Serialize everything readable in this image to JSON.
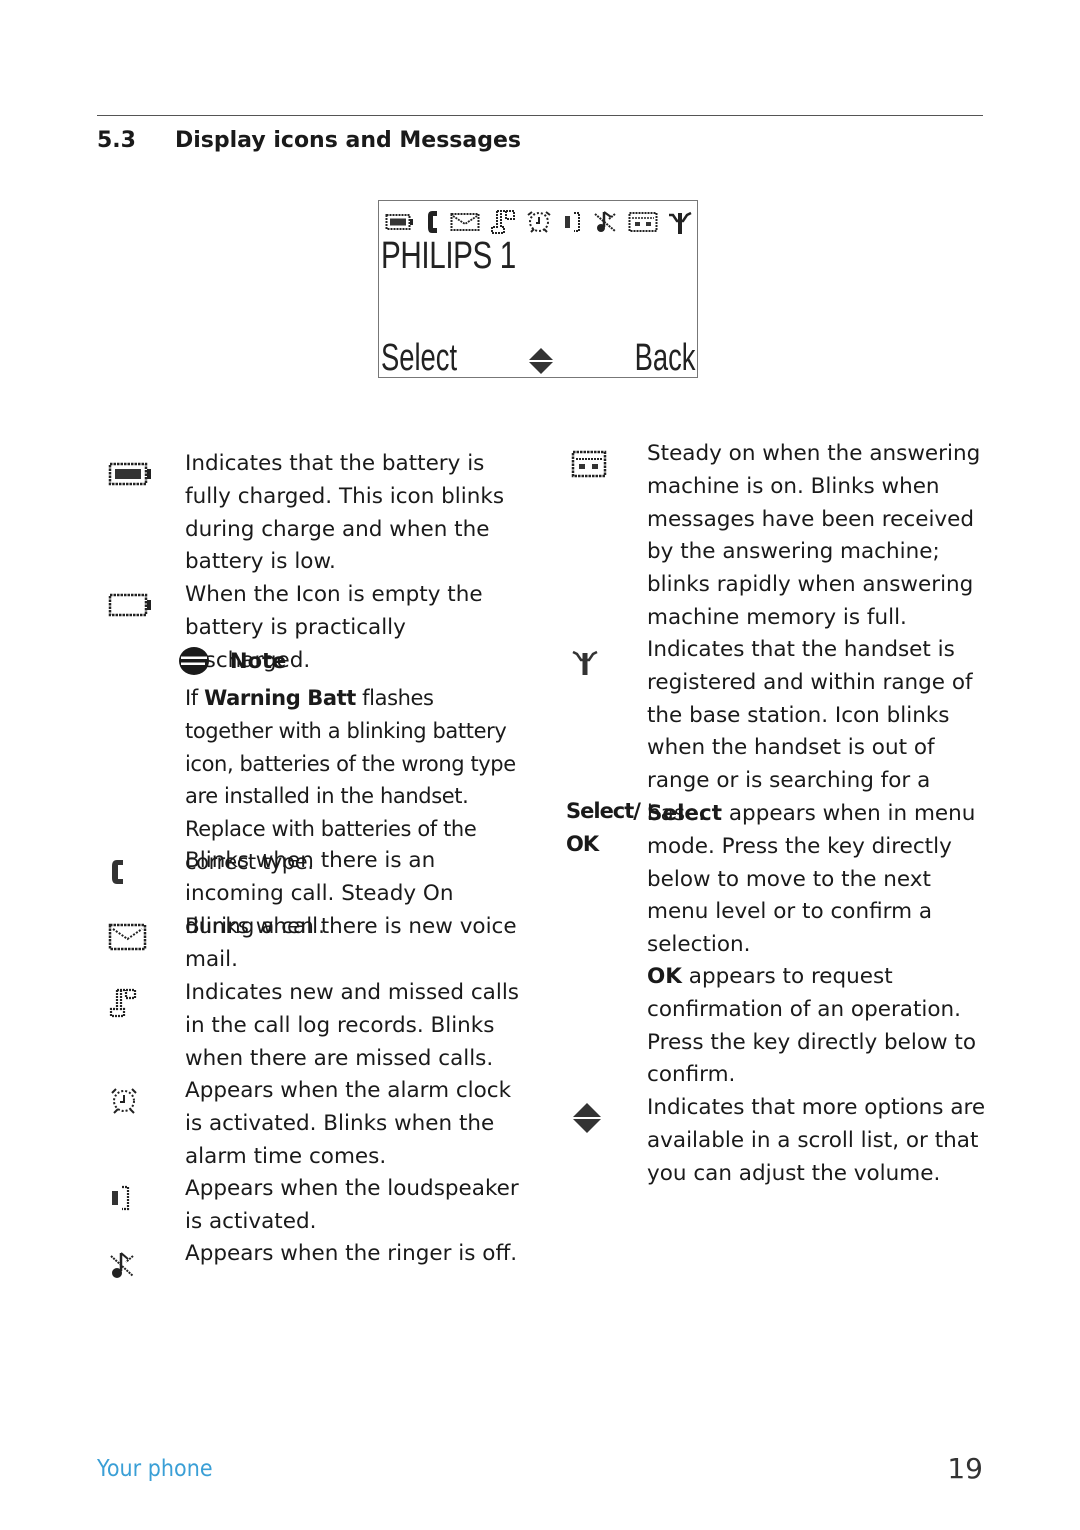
{
  "section": {
    "number": "5.3",
    "title": "Display icons and Messages"
  },
  "lcd": {
    "status_icons": [
      "battery-full-icon",
      "phone-handset-icon",
      "envelope-icon",
      "call-log-icon",
      "alarm-clock-icon",
      "loudspeaker-icon",
      "ringer-off-icon",
      "answering-machine-icon",
      "antenna-icon"
    ],
    "line1": "PHILIPS 1",
    "softkey_left": "Select",
    "softkey_center_icon": "scroll-arrows-icon",
    "softkey_right": "Back"
  },
  "left_column": {
    "battery_full": {
      "icon": "battery-full-icon",
      "text": "Indicates that the battery is fully charged. This icon blinks during charge and when the battery is low."
    },
    "battery_empty": {
      "icon": "battery-empty-icon",
      "text": "When the Icon is empty the battery is practically discharged."
    },
    "note": {
      "label": "Note",
      "prefix": "If ",
      "bold": "Warning Batt",
      "text": " flashes together with a blinking battery icon, batteries of the wrong type are installed in the handset. Replace with batteries of the correct type."
    },
    "incoming_call": {
      "icon": "phone-handset-icon",
      "text": "Blinks when there is an incoming call. Steady On during a call."
    },
    "voice_mail": {
      "icon": "envelope-icon",
      "text": "Blinks when there is new voice mail."
    },
    "call_log": {
      "icon": "call-log-icon",
      "text": "Indicates new and missed calls in the call log records. Blinks when there are missed calls."
    },
    "alarm": {
      "icon": "alarm-clock-icon",
      "text": "Appears when the alarm clock is activated. Blinks when the alarm time comes."
    },
    "loudspeaker": {
      "icon": "loudspeaker-icon",
      "text": "Appears when the loudspeaker is activated."
    },
    "ringer_off": {
      "icon": "ringer-off-icon",
      "text": "Appears when the ringer is off."
    }
  },
  "right_column": {
    "answering_machine": {
      "icon": "answering-machine-icon",
      "text": "Steady on when the answering machine is on. Blinks when messages have been received by the answering machine; blinks rapidly when answering machine memory is full."
    },
    "antenna": {
      "icon": "antenna-icon",
      "text": "Indicates that the handset is registered and within range of the base station. Icon blinks when the handset is out of range or is searching for a base."
    },
    "select_ok": {
      "key_label_1": "Select/",
      "key_label_2": "OK",
      "select_bold": "Select",
      "select_text": " appears when in menu mode. Press the key directly below to move to the next menu level or to confirm a selection.",
      "ok_bold": "OK",
      "ok_text": " appears to request confirmation of an operation. Press the key directly below to confirm."
    },
    "scroll": {
      "icon": "scroll-arrows-icon",
      "text": "Indicates that more options are available in a scroll list, or that you can adjust the volume."
    }
  },
  "footer": {
    "chapter": "Your phone",
    "page": "19",
    "chapter_color": "#3a9fd6"
  }
}
